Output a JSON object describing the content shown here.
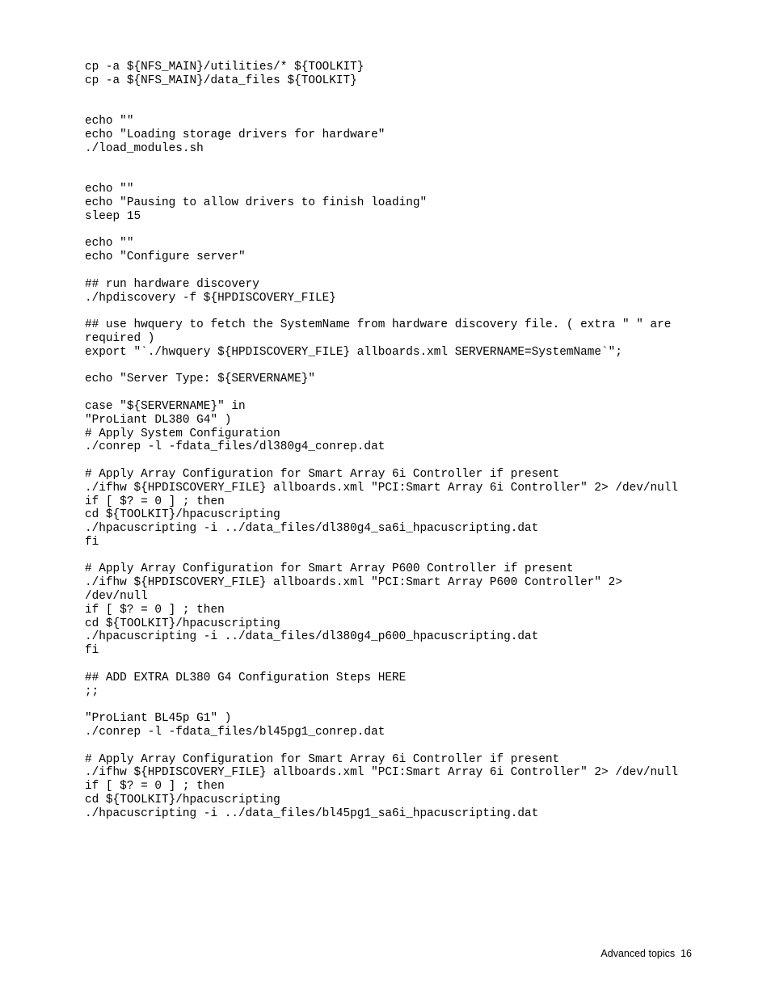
{
  "code": "cp -a ${NFS_MAIN}/utilities/* ${TOOLKIT}\ncp -a ${NFS_MAIN}/data_files ${TOOLKIT}\n\n\necho \"\"\necho \"Loading storage drivers for hardware\"\n./load_modules.sh\n\n\necho \"\"\necho \"Pausing to allow drivers to finish loading\"\nsleep 15\n\necho \"\"\necho \"Configure server\"\n\n## run hardware discovery\n./hpdiscovery -f ${HPDISCOVERY_FILE}\n\n## use hwquery to fetch the SystemName from hardware discovery file. ( extra \" \" are required )\nexport \"`./hwquery ${HPDISCOVERY_FILE} allboards.xml SERVERNAME=SystemName`\";\n\necho \"Server Type: ${SERVERNAME}\"\n\ncase \"${SERVERNAME}\" in\n\"ProLiant DL380 G4\" )\n# Apply System Configuration\n./conrep -l -fdata_files/dl380g4_conrep.dat\n\n# Apply Array Configuration for Smart Array 6i Controller if present\n./ifhw ${HPDISCOVERY_FILE} allboards.xml \"PCI:Smart Array 6i Controller\" 2> /dev/null\nif [ $? = 0 ] ; then\ncd ${TOOLKIT}/hpacuscripting\n./hpacuscripting -i ../data_files/dl380g4_sa6i_hpacuscripting.dat\nfi\n\n# Apply Array Configuration for Smart Array P600 Controller if present\n./ifhw ${HPDISCOVERY_FILE} allboards.xml \"PCI:Smart Array P600 Controller\" 2> /dev/null\nif [ $? = 0 ] ; then\ncd ${TOOLKIT}/hpacuscripting\n./hpacuscripting -i ../data_files/dl380g4_p600_hpacuscripting.dat\nfi\n\n## ADD EXTRA DL380 G4 Configuration Steps HERE\n;;\n\n\"ProLiant BL45p G1\" )\n./conrep -l -fdata_files/bl45pg1_conrep.dat\n\n# Apply Array Configuration for Smart Array 6i Controller if present\n./ifhw ${HPDISCOVERY_FILE} allboards.xml \"PCI:Smart Array 6i Controller\" 2> /dev/null\nif [ $? = 0 ] ; then\ncd ${TOOLKIT}/hpacuscripting\n./hpacuscripting -i ../data_files/bl45pg1_sa6i_hpacuscripting.dat",
  "footer": {
    "section": "Advanced topics",
    "page": "16"
  }
}
